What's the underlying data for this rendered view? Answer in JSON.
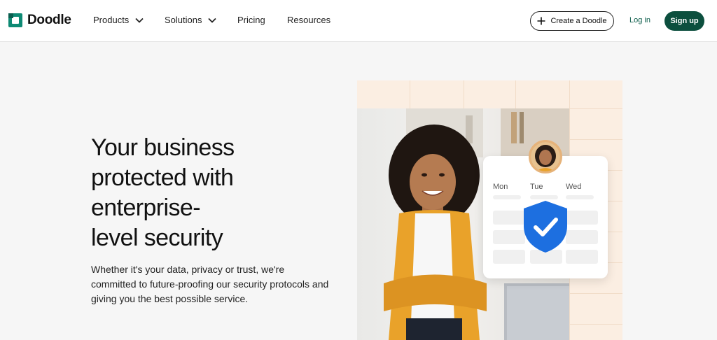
{
  "brand": {
    "name": "Doodle",
    "color": "#0c4f3e",
    "logo_color": "#0e8a74"
  },
  "nav": {
    "items": [
      {
        "label": "Products",
        "has_dropdown": true
      },
      {
        "label": "Solutions",
        "has_dropdown": true
      },
      {
        "label": "Pricing",
        "has_dropdown": false
      },
      {
        "label": "Resources",
        "has_dropdown": false
      }
    ],
    "create_label": "Create a Doodle",
    "login_label": "Log in",
    "signup_label": "Sign up"
  },
  "hero": {
    "title_lines": [
      "Your business",
      "protected with",
      "enterprise-",
      "level security"
    ],
    "body": "Whether it's your data, privacy or trust, we're committed to future-proofing our security protocols and giving you the best possible service."
  },
  "calendar_card": {
    "days": [
      "Mon",
      "Tue",
      "Wed"
    ],
    "shield_color": "#1d6fe0"
  },
  "icons": [
    "chevron-down-icon",
    "plus-icon",
    "shield-check-icon"
  ]
}
